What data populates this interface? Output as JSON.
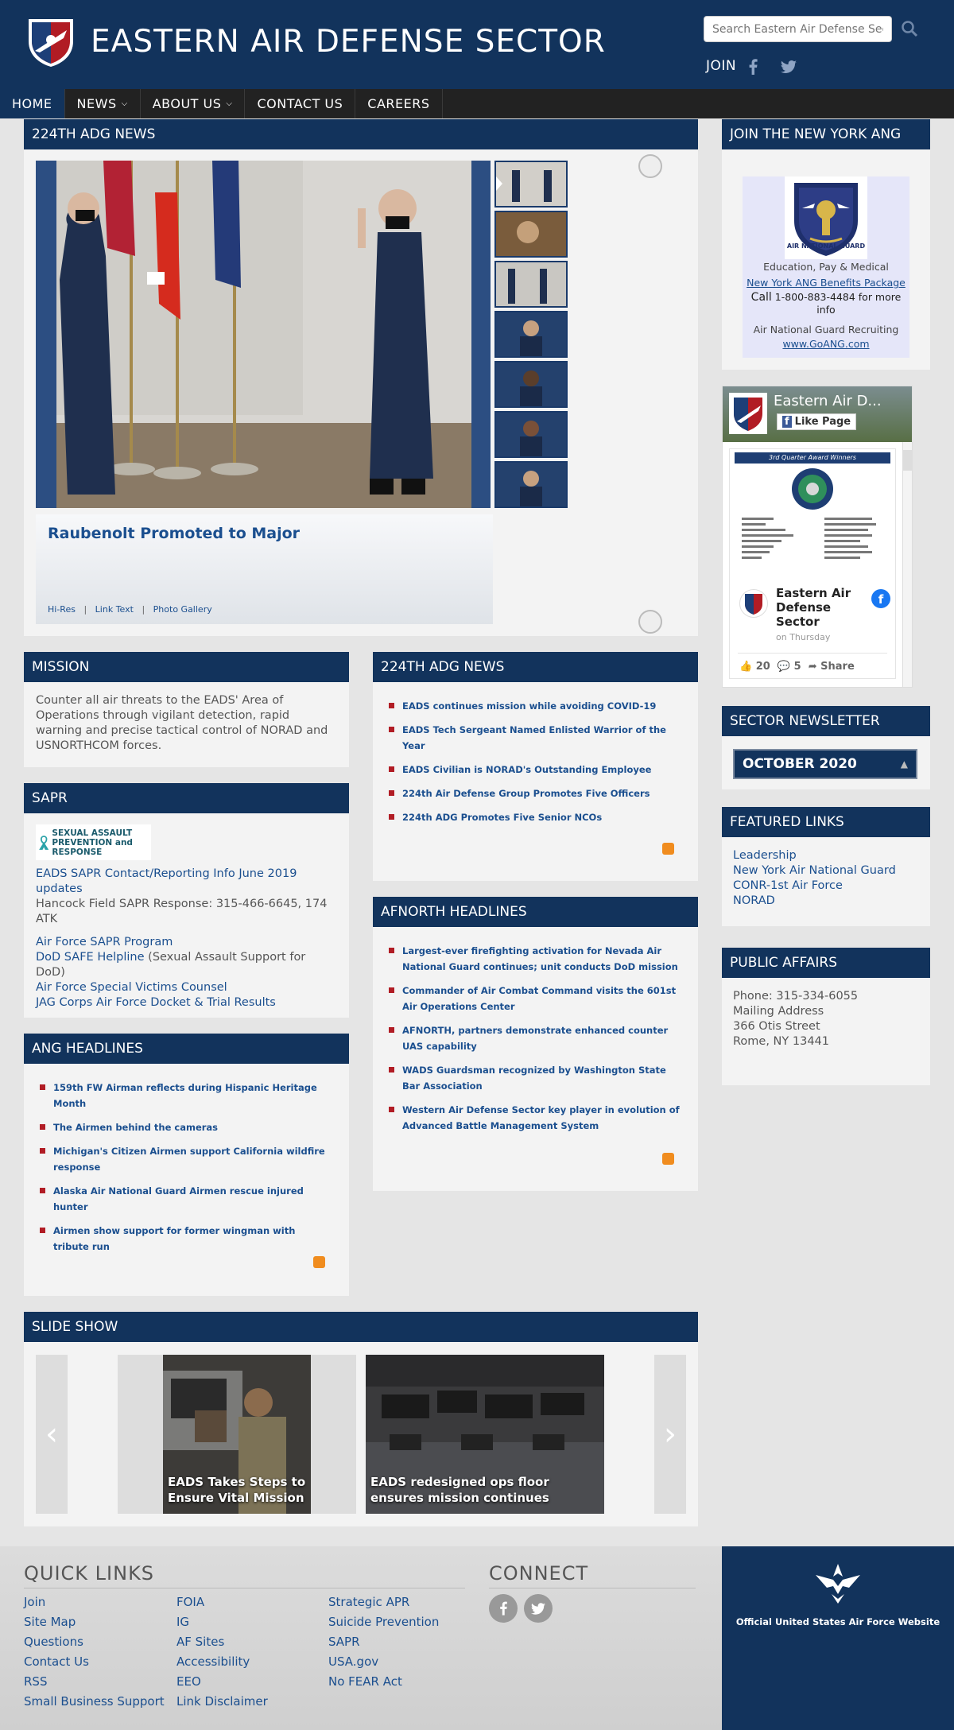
{
  "header": {
    "site_title": "EASTERN AIR DEFENSE SECTOR",
    "search_placeholder": "Search Eastern Air Defense Sect",
    "join_label": "JOIN"
  },
  "nav": {
    "items": [
      {
        "label": "HOME",
        "active": true,
        "dropdown": false
      },
      {
        "label": "NEWS",
        "active": false,
        "dropdown": true
      },
      {
        "label": "ABOUT US",
        "active": false,
        "dropdown": true
      },
      {
        "label": "CONTACT US",
        "active": false,
        "dropdown": false
      },
      {
        "label": "CAREERS",
        "active": false,
        "dropdown": false
      }
    ]
  },
  "feature": {
    "heading": "224TH ADG NEWS",
    "title": "Raubenolt Promoted to Major",
    "links": [
      "Hi-Res",
      "Link Text",
      "Photo Gallery"
    ],
    "separator": "|"
  },
  "mission": {
    "heading": "MISSION",
    "text": "Counter all air threats to the EADS' Area of Operations through vigilant detection, rapid warning and precise tactical control of NORAD and USNORTHCOM forces."
  },
  "sapr": {
    "heading": "SAPR",
    "logo_text": "SEXUAL ASSAULT PREVENTION and RESPONSE",
    "link1": "EADS SAPR Contact/Reporting Info June 2019 updates",
    "response": "Hancock Field SAPR Response: 315-466-6645, 174 ATK",
    "link2": "Air Force SAPR Program",
    "link3": "DoD SAFE Helpline",
    "link3_suffix": " (Sexual Assault Support for DoD)",
    "link4": "Air Force Special Victims Counsel",
    "link5": "JAG Corps Air Force Docket & Trial Results"
  },
  "ang": {
    "heading": "ANG HEADLINES",
    "items": [
      "159th FW Airman reflects during Hispanic Heritage Month",
      "The Airmen behind the cameras",
      "Michigan's Citizen Airmen support California wildfire response",
      "Alaska Air National Guard Airmen rescue injured hunter",
      "Airmen show support for former wingman with tribute run"
    ]
  },
  "adg_news": {
    "heading": "224TH ADG NEWS",
    "items": [
      "EADS continues mission while avoiding COVID-19",
      "EADS Tech Sergeant Named Enlisted Warrior of the Year",
      "EADS Civilian is NORAD's Outstanding Employee",
      "224th Air Defense Group Promotes Five Officers",
      "224th ADG Promotes Five Senior NCOs"
    ]
  },
  "afnorth": {
    "heading": "AFNORTH HEADLINES",
    "items": [
      "Largest-ever firefighting activation for Nevada Air National Guard continues; unit conducts DoD mission",
      "Commander of Air Combat Command visits the 601st Air Operations Center",
      "AFNORTH, partners demonstrate enhanced counter UAS capability",
      "WADS Guardsman recognized by Washington State Bar Association",
      "Western Air Defense Sector key player in evolution of Advanced Battle Management System"
    ]
  },
  "slideshow": {
    "heading": "SLIDE SHOW",
    "slides": [
      {
        "caption": "EADS Takes Steps to Ensure Vital Mission"
      },
      {
        "caption": "EADS redesigned ops floor ensures mission continues"
      }
    ]
  },
  "join_ang": {
    "heading": "JOIN THE NEW YORK ANG",
    "badge_text": "AIR NATIONAL GUARD",
    "line1": "Education, Pay & Medical",
    "link1": "New York ANG Benefits Package",
    "call_prefix": "Call",
    "call_number": " 1-800-883-4484 for more info",
    "recruiting": "Air National Guard Recruiting",
    "link2": "www.GoANG.com"
  },
  "facebook": {
    "page_name": "Eastern Air D...",
    "like_label": "Like Page",
    "award_banner": "3rd Quarter Award Winners",
    "post_author": "Eastern Air Defense Sector",
    "post_time": "on Thursday",
    "likes": "20",
    "comments": "5",
    "share": "Share"
  },
  "newsletter": {
    "heading": "SECTOR NEWSLETTER",
    "selected": "OCTOBER 2020"
  },
  "featured": {
    "heading": "FEATURED LINKS",
    "links": [
      "Leadership",
      "New York Air National Guard",
      "CONR-1st Air Force",
      "NORAD"
    ]
  },
  "public_affairs": {
    "heading": "PUBLIC AFFAIRS",
    "phone": "Phone: 315-334-6055",
    "mailing": "Mailing Address",
    "street": "366 Otis Street",
    "city": "Rome, NY 13441"
  },
  "footer": {
    "quick_links_title": "QUICK LINKS",
    "col1": [
      "Join",
      "Site Map",
      "Questions",
      "Contact Us",
      "RSS",
      "Small Business Support"
    ],
    "col2": [
      "FOIA",
      "IG",
      "AF Sites",
      "Accessibility",
      "EEO",
      "Link Disclaimer"
    ],
    "col3": [
      "Strategic APR",
      "Suicide Prevention",
      "SAPR",
      "USA.gov",
      "No FEAR Act"
    ],
    "connect_title": "CONNECT",
    "af_text": "Official United States Air Force Website"
  }
}
